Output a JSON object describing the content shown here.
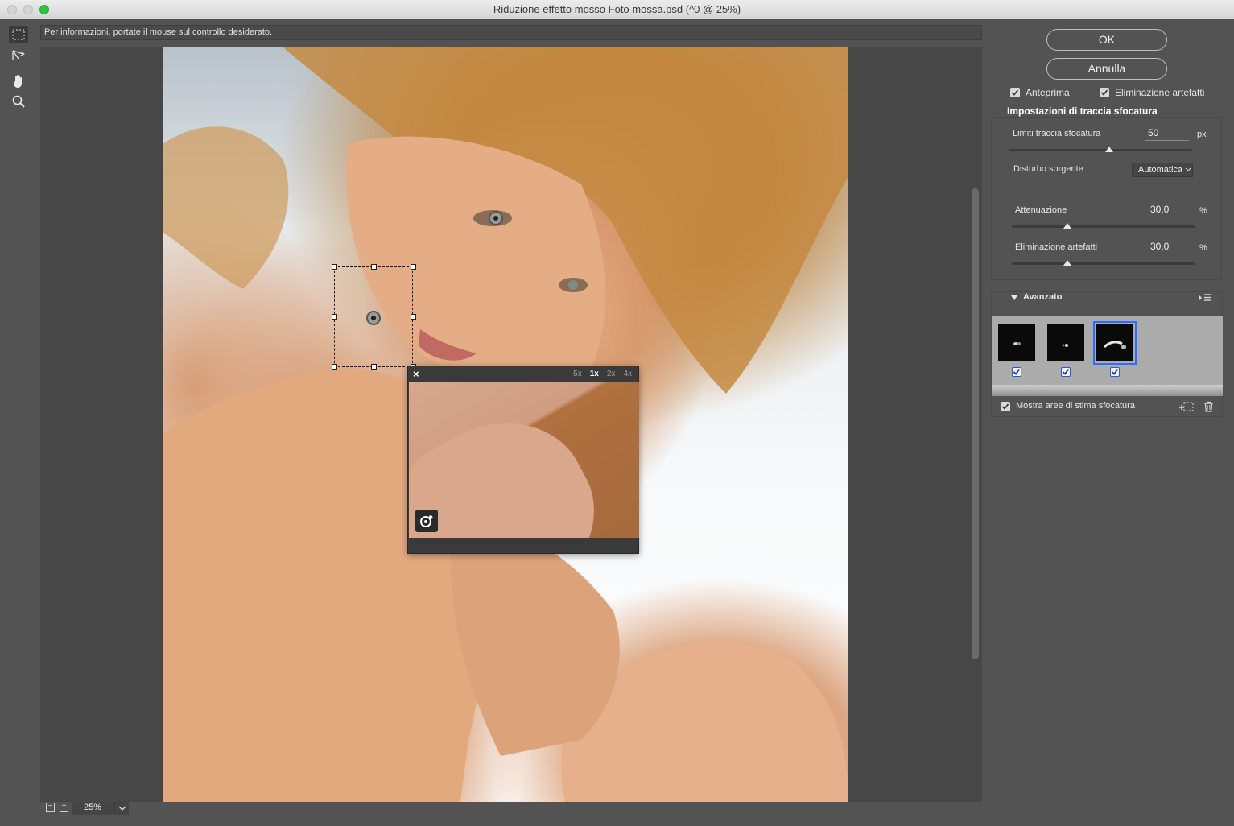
{
  "window": {
    "title": "Riduzione effetto mosso Foto mossa.psd (^0 @ 25%)"
  },
  "tools": [
    {
      "name": "blur-estimation-tool",
      "icon": "marquee-icon"
    },
    {
      "name": "blur-direction-tool",
      "icon": "direction-arrow-icon"
    },
    {
      "name": "hand-tool",
      "icon": "hand-icon"
    },
    {
      "name": "zoom-tool",
      "icon": "magnifier-icon"
    }
  ],
  "info_bar": {
    "text": "Per informazioni, portate il mouse sul controllo desiderato."
  },
  "loupe": {
    "close": "×",
    "zoom_options": [
      ".5x",
      "1x",
      "2x",
      "4x"
    ],
    "zoom_selected": "1x"
  },
  "zoom": {
    "minus": "−",
    "plus": "+",
    "value": "25%"
  },
  "buttons": {
    "ok": "OK",
    "cancel": "Annulla"
  },
  "options": {
    "preview_label": "Anteprima",
    "preview_checked": true,
    "artifact_label": "Eliminazione artefatti",
    "artifact_checked": true
  },
  "settings": {
    "group_title": "Impostazioni di traccia sfocatura",
    "blur_trace_label": "Limiti traccia sfocatura",
    "blur_trace_value": "50",
    "blur_trace_unit": "px",
    "source_noise_label": "Disturbo sorgente",
    "source_noise_value": "Automatica",
    "smoothing_label": "Attenuazione",
    "smoothing_value": "30,0",
    "smoothing_unit": "%",
    "artifact_suppression_label": "Eliminazione artefatti",
    "artifact_suppression_value": "30,0",
    "artifact_suppression_unit": "%"
  },
  "advanced": {
    "title": "Avanzato",
    "kernels": [
      {
        "checked": true,
        "selected": false
      },
      {
        "checked": true,
        "selected": false
      },
      {
        "checked": true,
        "selected": true
      }
    ],
    "show_regions_label": "Mostra aree di stima sfocatura",
    "show_regions_checked": true
  },
  "colors": {
    "accent_blue": "#2e6cff",
    "panel_bg": "#535353",
    "window_green": "#2ec440"
  }
}
